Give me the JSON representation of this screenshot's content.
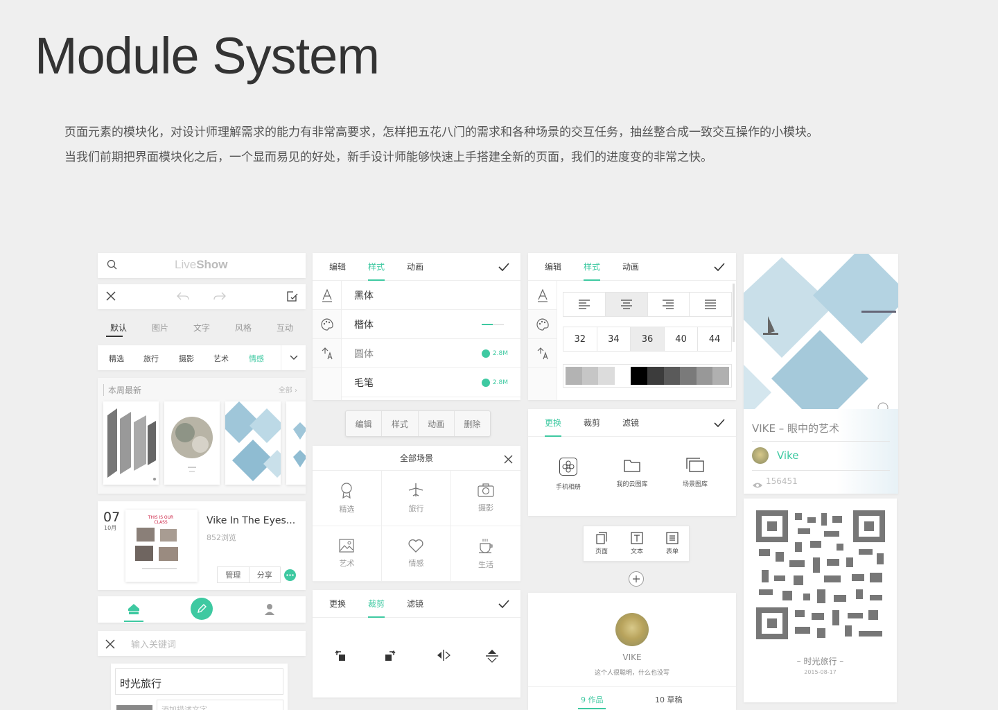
{
  "title": "Module System",
  "description": {
    "line1": "页面元素的模块化，对设计师理解需求的能力有非常高要求，怎样把五花八门的需求和各种场景的交互任务，抽丝整合成一致交互操作的小模块。",
    "line2": "当我们前期把界面模块化之后，一个显而易见的好处，新手设计师能够快速上手搭建全新的页面，我们的进度变的非常之快。"
  },
  "colors": {
    "accent": "#3ec9a1",
    "bg": "#efefef"
  },
  "col1": {
    "logo": {
      "part1": "Live",
      "part2": "Show"
    },
    "top_tabs": [
      "默认",
      "图片",
      "文字",
      "风格",
      "互动"
    ],
    "cat_tabs": [
      "精选",
      "旅行",
      "摄影",
      "艺术",
      "情感"
    ],
    "weekly": {
      "title": "本周最新",
      "more": "全部 ›"
    },
    "post": {
      "day": "07",
      "month": "10月",
      "title": "Vike In The Eyes...",
      "views": "852浏览",
      "manage": "管理",
      "share": "分享",
      "thumb_title": "THIS IS OUR CLASS"
    },
    "search_placeholder": "输入关键词",
    "form": {
      "title": "时光旅行",
      "desc_placeholder": "添加描述文字"
    }
  },
  "col2": {
    "tabs": [
      "编辑",
      "样式",
      "动画"
    ],
    "fonts": [
      {
        "name": "黑体"
      },
      {
        "name": "楷体"
      },
      {
        "name": "圆体",
        "size": "2.8M"
      },
      {
        "name": "毛笔",
        "size": "2.8M"
      }
    ],
    "pill_menu": [
      "编辑",
      "样式",
      "动画",
      "删除"
    ],
    "scenes": {
      "title": "全部场景",
      "items": [
        {
          "label": "精选",
          "icon": "badge-icon"
        },
        {
          "label": "旅行",
          "icon": "plane-icon"
        },
        {
          "label": "摄影",
          "icon": "camera-icon"
        },
        {
          "label": "艺术",
          "icon": "picture-icon"
        },
        {
          "label": "情感",
          "icon": "heart-icon"
        },
        {
          "label": "生活",
          "icon": "cup-icon"
        }
      ]
    },
    "crop_tabs": [
      "更换",
      "裁剪",
      "滤镜"
    ]
  },
  "col3": {
    "tabs": [
      "编辑",
      "样式",
      "动画"
    ],
    "sizes": [
      "32",
      "34",
      "36",
      "40",
      "44"
    ],
    "selected_size": "36",
    "swatches": [
      "#b3b3b3",
      "#c6c6c6",
      "#dcdcdc",
      "#ffffff",
      "#000000",
      "#3c3c3c",
      "#5a5a5a",
      "#7a7a7a",
      "#989898",
      "#b0b0b0"
    ],
    "image_tabs": [
      "更换",
      "裁剪",
      "滤镜"
    ],
    "sources": [
      "手机相册",
      "我的云图库",
      "场景图库"
    ],
    "add_menu": [
      "页面",
      "文本",
      "表单"
    ],
    "profile": {
      "name": "VIKE",
      "bio": "这个人很聪明，什么也没写",
      "works": "9 作品",
      "drafts": "10 草稿"
    }
  },
  "col4": {
    "card": {
      "title": "VIKE – 眼中的艺术",
      "author": "Vike",
      "views": "156451"
    },
    "qr": {
      "caption": "– 时光旅行 –",
      "date": "2015-08-17"
    }
  }
}
